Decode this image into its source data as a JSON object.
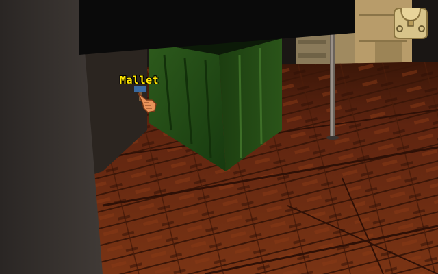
{
  "hotspot": {
    "label": "Mallet"
  },
  "hud": {
    "inventory_icon": "satchel-icon",
    "cursor_icon": "pointing-hand-icon"
  },
  "scene": {
    "objects": [
      "ceiling-beam",
      "green-crate",
      "metal-pole",
      "stacked-boxes",
      "wooden-floor",
      "stone-pillar",
      "mallet-item"
    ]
  },
  "colors": {
    "label_text": "#ffe600",
    "floor": "#6b2a10",
    "crate": "#1f4a14",
    "beam": "#0a0a0a"
  }
}
